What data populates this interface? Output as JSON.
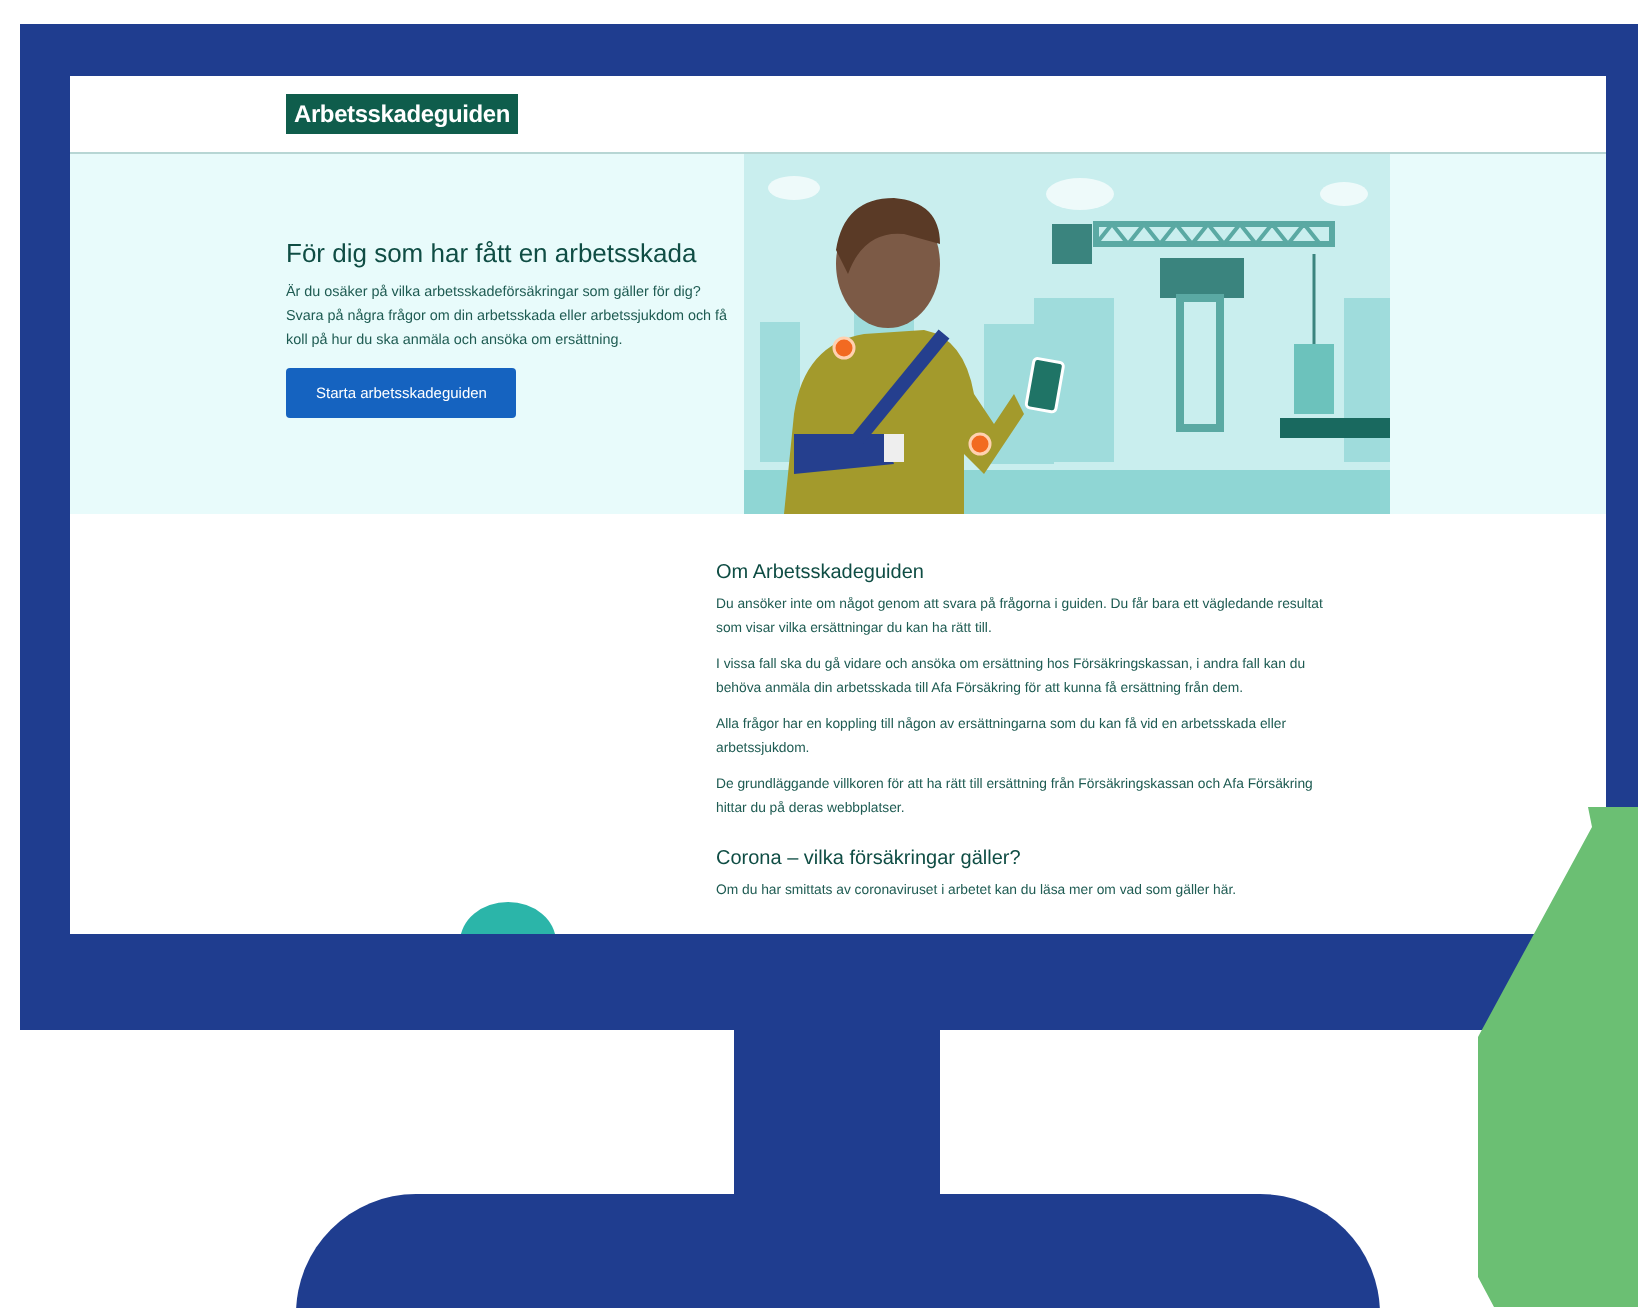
{
  "header": {
    "logo": "Arbetsskadeguiden"
  },
  "hero": {
    "title": "För dig som har fått en arbetsskada",
    "text": "Är du osäker på vilka arbetsskadeförsäkringar som gäller för dig? Svara på några frågor om din arbetsskada eller arbetssjukdom och få koll på hur du ska anmäla och ansöka om ersättning.",
    "button": "Starta arbetsskadeguiden"
  },
  "sections": [
    {
      "heading": "Om Arbetsskadeguiden",
      "paragraphs": [
        "Du ansöker inte om något genom att svara på frågorna i guiden. Du får bara ett vägledande resultat som visar vilka ersättningar du kan ha rätt till.",
        "I vissa fall ska du gå vidare och ansöka om ersättning hos Försäkringskassan, i andra fall kan du behöva anmäla din arbetsskada till Afa Försäkring för att kunna få ersättning från dem.",
        "Alla frågor har en koppling till någon av ersättningarna som du kan få vid en arbetsskada eller arbetssjukdom.",
        "De grundläggande villkoren för att ha rätt till ersättning från Försäkringskassan och Afa Försäkring hittar du på deras webbplatser."
      ]
    },
    {
      "heading": "Corona – vilka försäkringar gäller?",
      "paragraphs": [
        "Om du har smittats av coronaviruset i arbetet kan du läsa mer om vad som gäller här."
      ]
    }
  ]
}
